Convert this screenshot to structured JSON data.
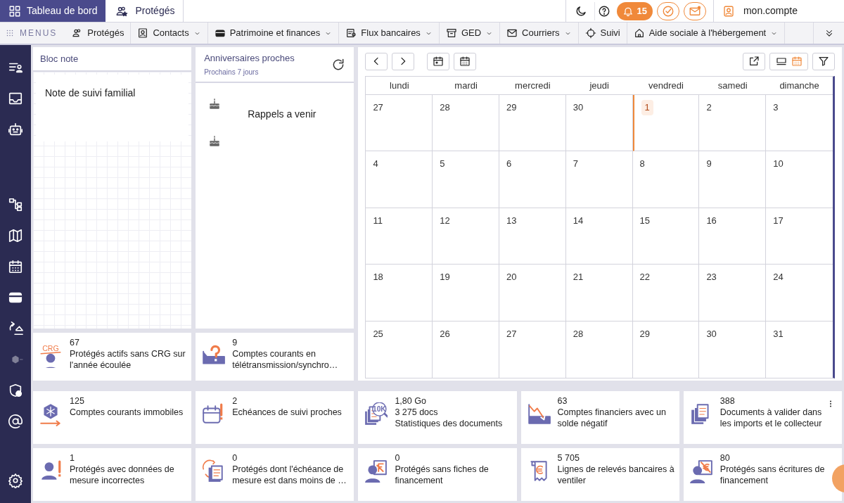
{
  "top_bar": {
    "tabs": [
      {
        "label": "Tableau de bord",
        "selected": true
      },
      {
        "label": "Protégés",
        "selected": false
      }
    ],
    "notifications": "15",
    "account": "mon.compte"
  },
  "menu_bar": {
    "label": "MENUS",
    "items": [
      {
        "label": "Protégés",
        "dropdown": false
      },
      {
        "label": "Contacts",
        "dropdown": true
      },
      {
        "label": "Patrimoine et finances",
        "dropdown": true
      },
      {
        "label": "Flux bancaires",
        "dropdown": true
      },
      {
        "label": "GED",
        "dropdown": true
      },
      {
        "label": "Courriers",
        "dropdown": true
      },
      {
        "label": "Suivi",
        "dropdown": false
      },
      {
        "label": "Aide sociale à l'hébergement",
        "dropdown": true
      }
    ]
  },
  "notes": {
    "title": "Bloc note",
    "text": "Note de suivi familial"
  },
  "birthdays": {
    "title": "Anniversaires proches",
    "subtitle": "Prochains 7 jours",
    "reminder": "Rappels a venir"
  },
  "calendar": {
    "weekdays": [
      "lundi",
      "mardi",
      "mercredi",
      "jeudi",
      "vendredi",
      "samedi",
      "dimanche"
    ],
    "weeks": [
      [
        {
          "day": "27",
          "today": false
        },
        {
          "day": "28",
          "today": false
        },
        {
          "day": "29",
          "today": false
        },
        {
          "day": "30",
          "today": false
        },
        {
          "day": "1",
          "today": true
        },
        {
          "day": "2",
          "today": false
        },
        {
          "day": "3",
          "today": false
        }
      ],
      [
        {
          "day": "4",
          "today": false
        },
        {
          "day": "5",
          "today": false
        },
        {
          "day": "6",
          "today": false
        },
        {
          "day": "7",
          "today": false
        },
        {
          "day": "8",
          "today": false
        },
        {
          "day": "9",
          "today": false
        },
        {
          "day": "10",
          "today": false
        }
      ],
      [
        {
          "day": "11",
          "today": false
        },
        {
          "day": "12",
          "today": false
        },
        {
          "day": "13",
          "today": false
        },
        {
          "day": "14",
          "today": false
        },
        {
          "day": "15",
          "today": false
        },
        {
          "day": "16",
          "today": false
        },
        {
          "day": "17",
          "today": false
        }
      ],
      [
        {
          "day": "18",
          "today": false
        },
        {
          "day": "19",
          "today": false
        },
        {
          "day": "20",
          "today": false
        },
        {
          "day": "21",
          "today": false
        },
        {
          "day": "22",
          "today": false
        },
        {
          "day": "23",
          "today": false
        },
        {
          "day": "24",
          "today": false
        }
      ],
      [
        {
          "day": "25",
          "today": false
        },
        {
          "day": "26",
          "today": false
        },
        {
          "day": "27",
          "today": false
        },
        {
          "day": "28",
          "today": false
        },
        {
          "day": "29",
          "today": false
        },
        {
          "day": "30",
          "today": false
        },
        {
          "day": "31",
          "today": false
        }
      ]
    ]
  },
  "stat_cards": [
    {
      "lines": [
        "67"
      ],
      "label": "Protégés actifs sans CRG sur l'année écoulée",
      "icon_text": "CRG"
    },
    {
      "lines": [
        "9"
      ],
      "label": "Comptes courants en télétransmission/synchro…"
    },
    {
      "lines": [
        "125"
      ],
      "label": "Comptes courants immobiles"
    },
    {
      "lines": [
        "2"
      ],
      "label": "Echéances de suivi proches"
    },
    {
      "lines": [
        "1,80 Go",
        "3 275 docs"
      ],
      "label": "Statistiques des documents",
      "icon_text": "10K"
    },
    {
      "lines": [
        "63"
      ],
      "label": "Comptes financiers avec un solde négatif"
    },
    {
      "lines": [
        "388"
      ],
      "label": "Documents à valider dans les imports et le collecteur"
    },
    {
      "lines": [
        "1"
      ],
      "label": "Protégés avec données de mesure incorrectes"
    },
    {
      "lines": [
        "0"
      ],
      "label": "Protégés dont l'échéance de mesure est dans moins de …"
    },
    {
      "lines": [
        "0"
      ],
      "label": "Protégés sans fiches de financement"
    },
    {
      "lines": [
        "5 705"
      ],
      "label": "Lignes de relevés bancaires à ventiler"
    },
    {
      "lines": [
        "80"
      ],
      "label": "Protégés sans écritures de financement"
    }
  ]
}
